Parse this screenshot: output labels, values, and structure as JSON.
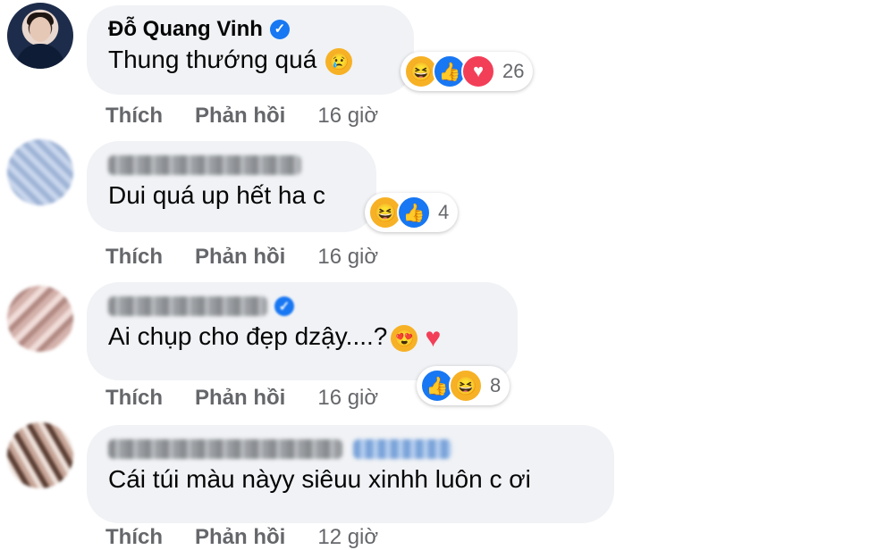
{
  "comments": [
    {
      "author": "Đỗ Quang Vinh",
      "verified": true,
      "text": "Thung thướng quá",
      "inline_emoji": "sad-face",
      "reactions": [
        "haha",
        "like",
        "love"
      ],
      "reaction_count": "26",
      "actions": {
        "like": "Thích",
        "reply": "Phản hồi",
        "time": "16 giờ"
      }
    },
    {
      "author": "",
      "verified": false,
      "text": "Dui quá up hết ha c",
      "reactions": [
        "haha",
        "like"
      ],
      "reaction_count": "4",
      "actions": {
        "like": "Thích",
        "reply": "Phản hồi",
        "time": "16 giờ"
      }
    },
    {
      "author": "",
      "verified": false,
      "text": "Ai chụp cho đẹp dzậy....?",
      "inline_emoji": [
        "heart-eyes",
        "red-heart"
      ],
      "reactions": [
        "like",
        "haha"
      ],
      "reaction_count": "8",
      "actions": {
        "like": "Thích",
        "reply": "Phản hồi",
        "time": "16 giờ"
      }
    },
    {
      "author": "",
      "verified": false,
      "text": "Cái túi màu nàyy siêuu xinhh luôn c ơi",
      "actions": {
        "like": "Thích",
        "reply": "Phản hồi",
        "time": "12 giờ"
      }
    }
  ],
  "colors": {
    "bubble": "#f0f2f5",
    "meta": "#65676b",
    "like": "#1877f2",
    "love": "#f33e58",
    "haha": "#f7b125"
  }
}
